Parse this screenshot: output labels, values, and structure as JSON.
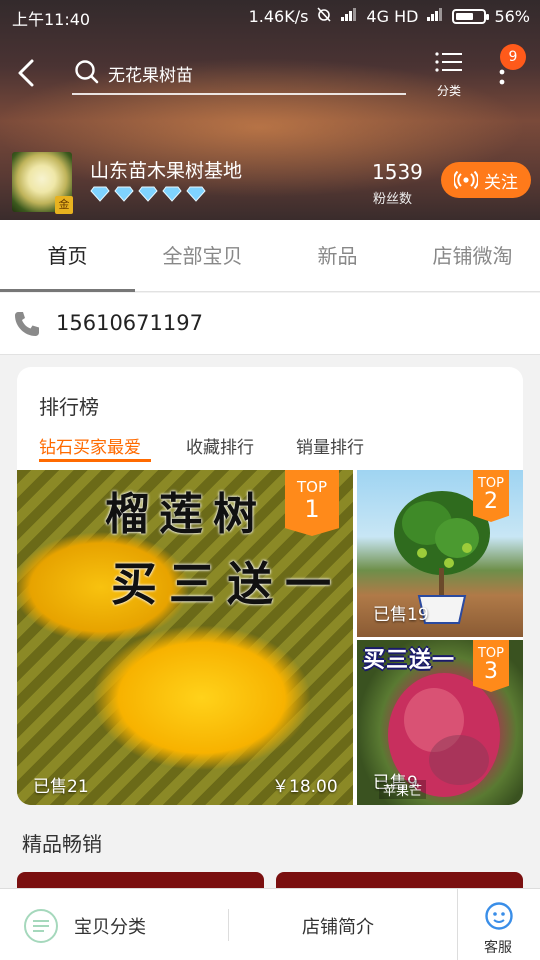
{
  "status_bar": {
    "time": "上午11:40",
    "network_speed": "1.46K/s",
    "network_type": "4G HD",
    "battery": "56%"
  },
  "header": {
    "search_text": "无花果树苗",
    "category_label": "分类",
    "notification_count": "9"
  },
  "shop": {
    "name": "山东苗木果树基地",
    "gold_badge": "金",
    "diamond_count": 5,
    "fans_count": "1539",
    "fans_label": "粉丝数",
    "follow_label": "关注"
  },
  "tabs": [
    {
      "label": "首页",
      "active": true
    },
    {
      "label": "全部宝贝",
      "active": false
    },
    {
      "label": "新品",
      "active": false
    },
    {
      "label": "店铺微淘",
      "active": false
    }
  ],
  "contact": {
    "phone": "15610671197"
  },
  "ranking": {
    "title": "排行榜",
    "tabs": [
      {
        "label": "钻石买家最爱",
        "active": true
      },
      {
        "label": "收藏排行",
        "active": false
      },
      {
        "label": "销量排行",
        "active": false
      }
    ],
    "items": [
      {
        "rank_top": "TOP",
        "rank_number": "1",
        "promo_line1": "榴莲树",
        "promo_line2": "买三送一",
        "sold": "已售21",
        "price": "￥18.00"
      },
      {
        "rank_top": "TOP",
        "rank_number": "2",
        "sold": "已售19"
      },
      {
        "rank_top": "TOP",
        "rank_number": "3",
        "promo": "买三送一",
        "sold": "已售9",
        "label": "苹果芒"
      }
    ]
  },
  "featured": {
    "title": "精品畅销"
  },
  "bottom_bar": {
    "category_label": "宝贝分类",
    "intro_label": "店铺简介",
    "service_label": "客服"
  },
  "colors": {
    "accent": "#ff6a00",
    "follow_button": "#ff7a1a",
    "badge": "#ff5a1a",
    "diamond": "#7fd3ff"
  },
  "icons": [
    "back-arrow-icon",
    "search-icon",
    "list-icon",
    "more-vertical-icon",
    "diamond-icon",
    "broadcast-icon",
    "phone-icon",
    "category-icon",
    "service-face-icon"
  ]
}
